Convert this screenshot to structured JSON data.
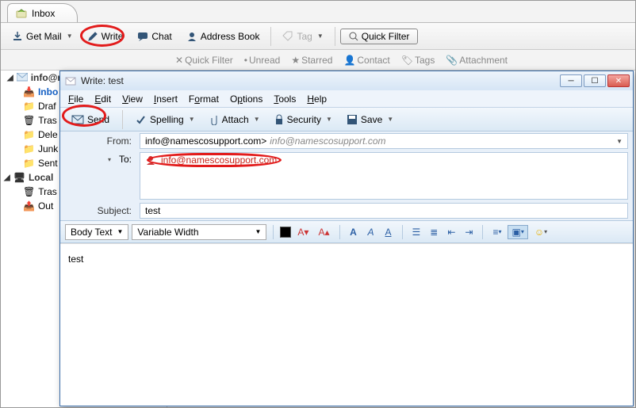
{
  "main_tab": {
    "label": "Inbox"
  },
  "toolbar": {
    "get_mail": "Get Mail",
    "write": "Write",
    "chat": "Chat",
    "address_book": "Address Book",
    "tag": "Tag",
    "quick_filter": "Quick Filter"
  },
  "filter_bar": {
    "quick_filter": "Quick Filter",
    "unread": "Unread",
    "starred": "Starred",
    "contact": "Contact",
    "tags": "Tags",
    "attachment": "Attachment"
  },
  "sidebar": {
    "account": "info@namescosupport.com",
    "folders": {
      "inbox": "Inbo",
      "drafts": "Draf",
      "trash": "Tras",
      "deleted": "Dele",
      "junk": "Junk",
      "sent": "Sent"
    },
    "local": "Local",
    "local_folders": {
      "trash": "Tras",
      "outbox": "Out"
    }
  },
  "compose": {
    "window_title": "Write: test",
    "menu": {
      "file": "File",
      "edit": "Edit",
      "view": "View",
      "insert": "Insert",
      "format": "Format",
      "options": "Options",
      "tools": "Tools",
      "help": "Help"
    },
    "buttons": {
      "send": "Send",
      "spelling": "Spelling",
      "attach": "Attach",
      "security": "Security",
      "save": "Save"
    },
    "headers": {
      "from_label": "From:",
      "from_value": "info@namescosupport.com>",
      "from_alias": "info@namescosupport.com",
      "to_label": "To:",
      "to_value": "info@namescosupport.com",
      "subject_label": "Subject:",
      "subject_value": "test"
    },
    "format_bar": {
      "style": "Body Text",
      "font": "Variable Width"
    },
    "body": "test"
  }
}
